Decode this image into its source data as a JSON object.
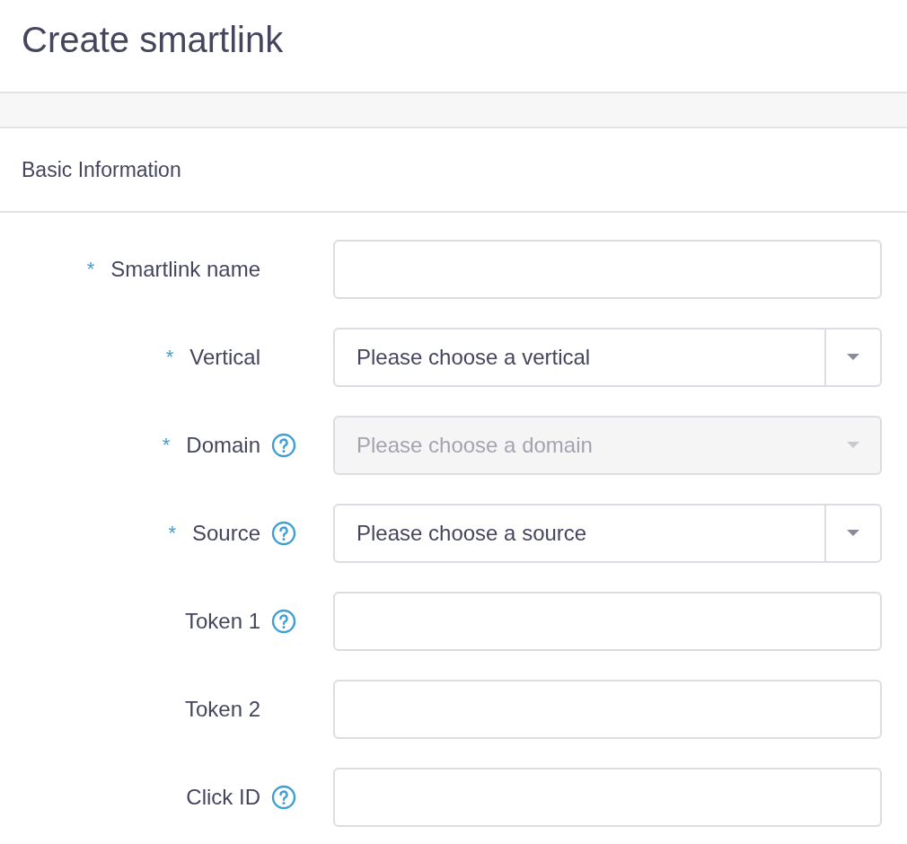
{
  "title": "Create smartlink",
  "section": {
    "title": "Basic Information"
  },
  "fields": [
    {
      "label": "Smartlink name",
      "kind": "input",
      "required_mark": "*",
      "help": false
    },
    {
      "label": "Vertical",
      "kind": "select",
      "required_mark": "*",
      "help": false,
      "placeholder": "Please choose a vertical",
      "disabled": false
    },
    {
      "label": "Domain",
      "kind": "select",
      "required_mark": "*",
      "help": true,
      "placeholder": "Please choose a domain",
      "disabled": true
    },
    {
      "label": "Source",
      "kind": "select",
      "required_mark": "*",
      "help": true,
      "placeholder": "Please choose a source",
      "disabled": false
    },
    {
      "label": "Token 1",
      "kind": "input",
      "help": true
    },
    {
      "label": "Token 2",
      "kind": "input",
      "help": false
    },
    {
      "label": "Click ID",
      "kind": "input",
      "help": true
    }
  ]
}
